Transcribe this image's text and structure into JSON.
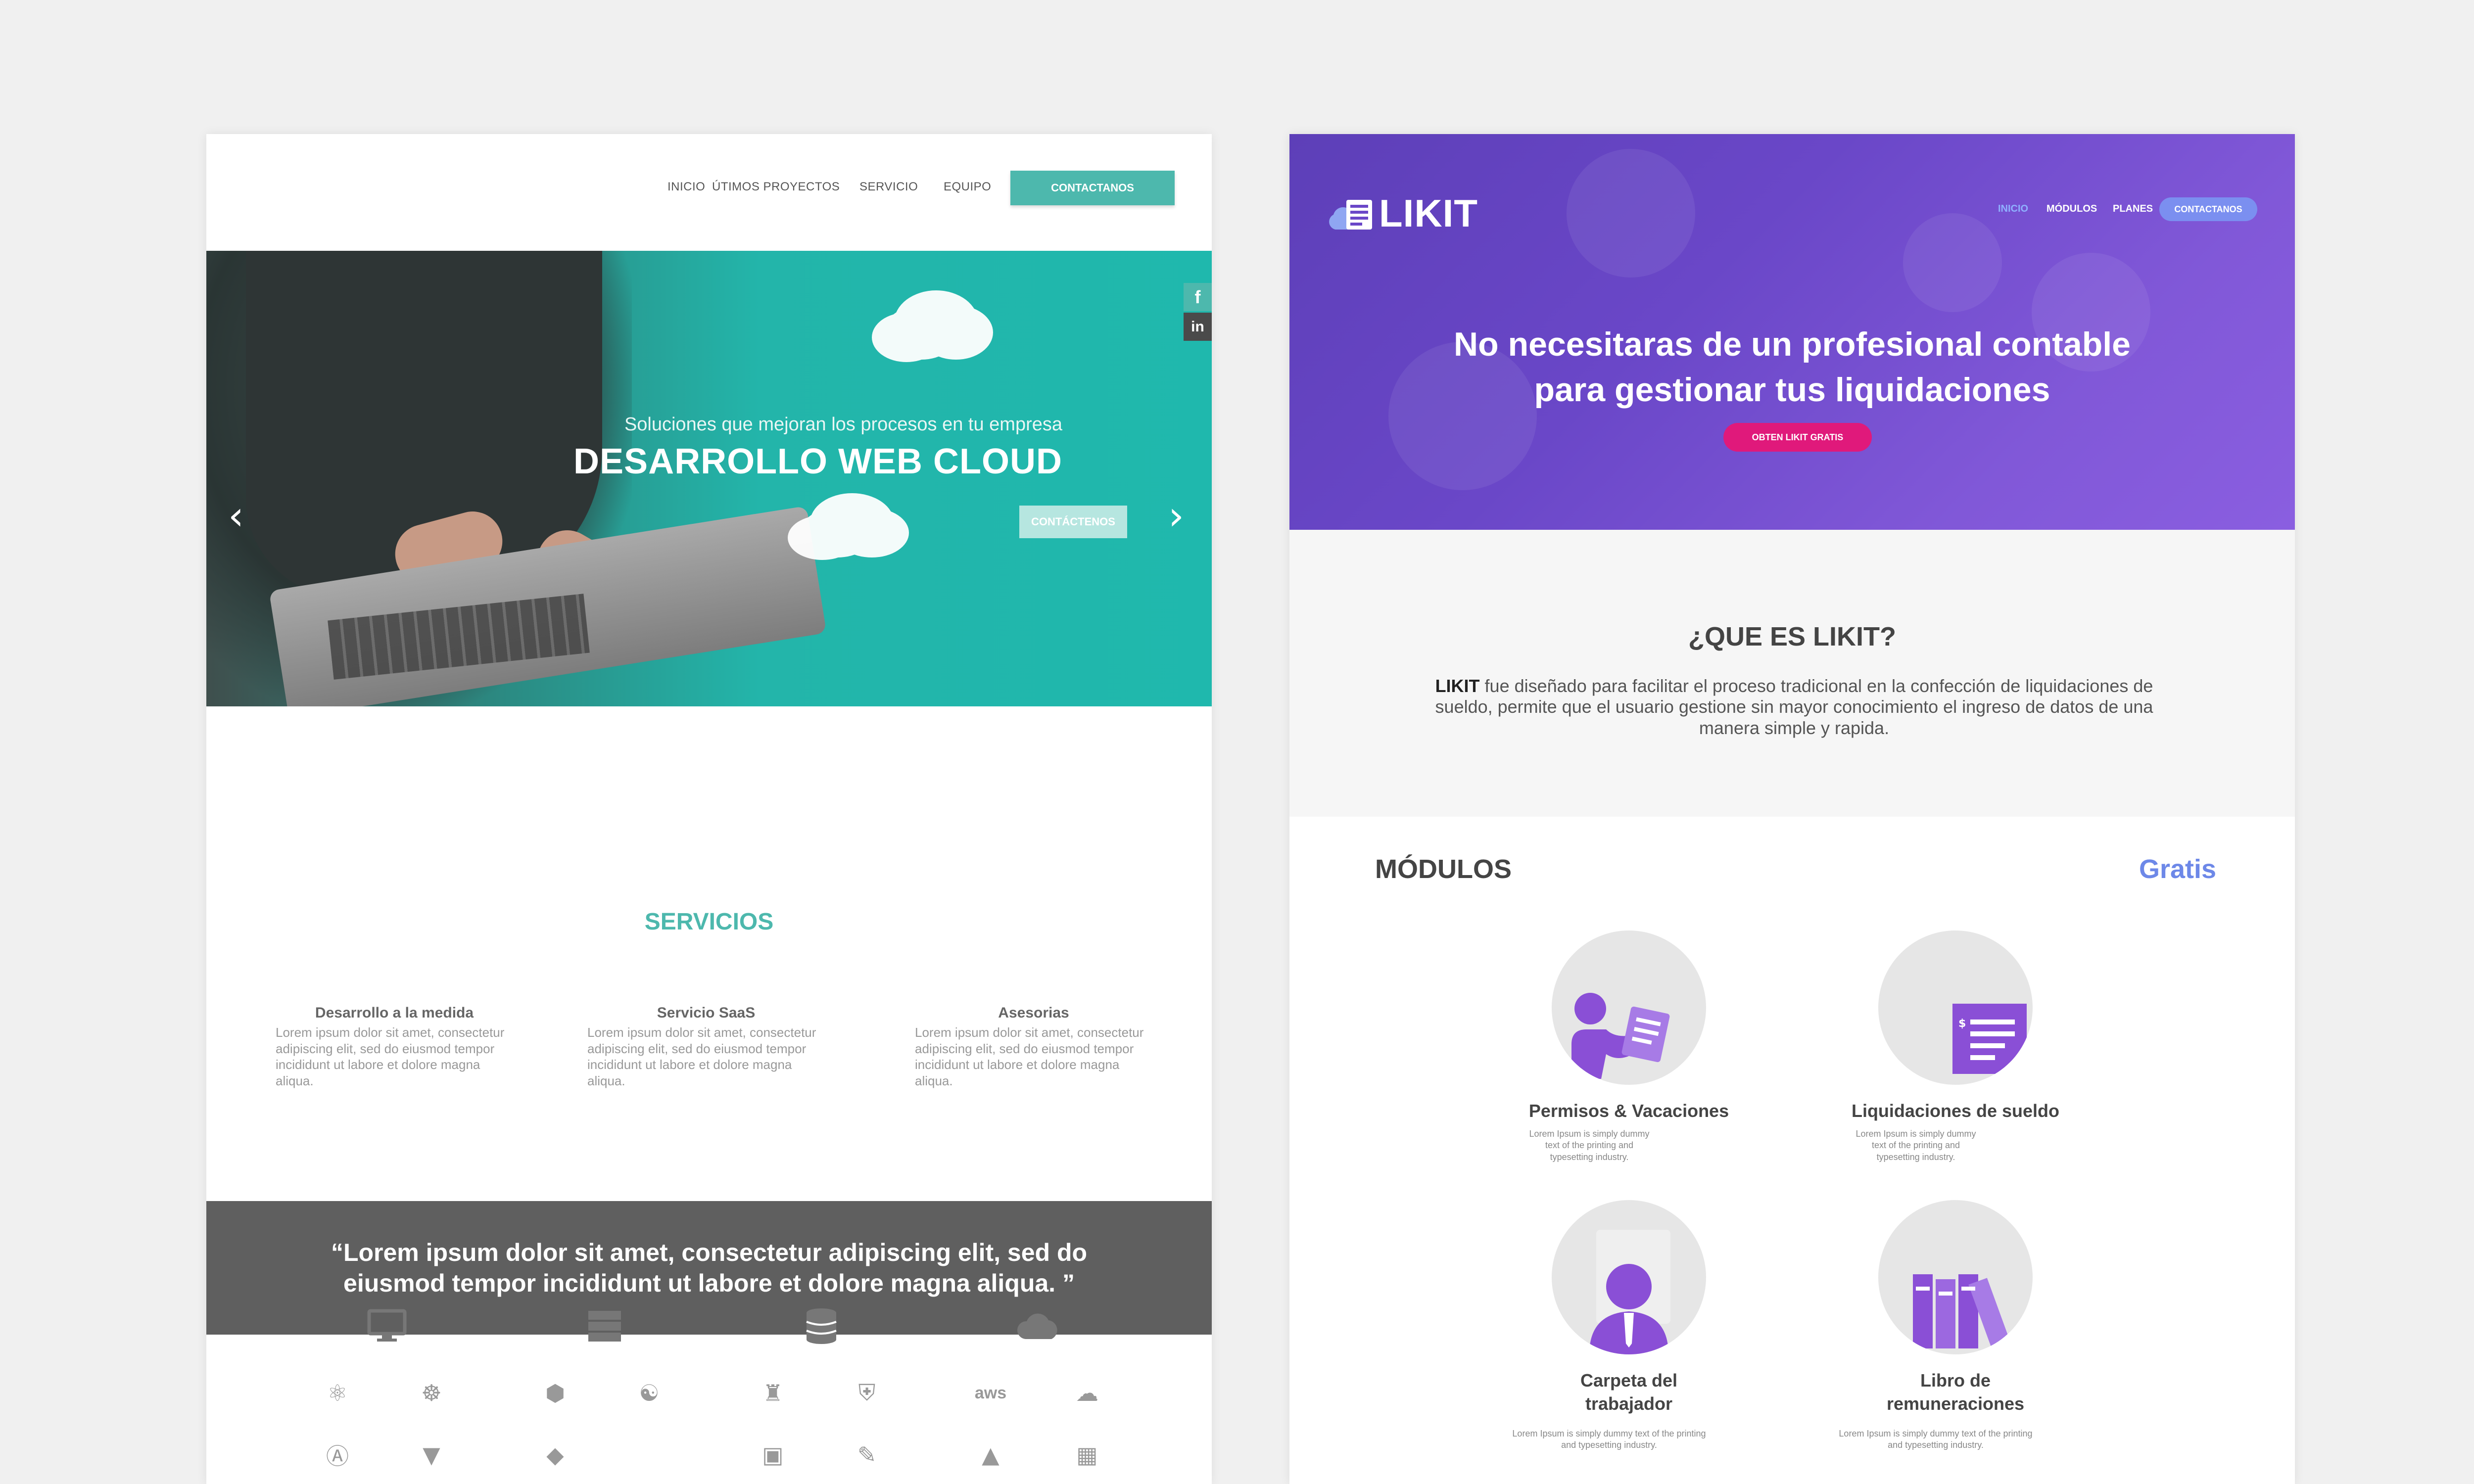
{
  "left_site": {
    "nav": {
      "items": [
        "INICIO",
        "ÚTIMOS PROYECTOS",
        "SERVICIO",
        "EQUIPO"
      ],
      "cta": "CONTACTANOS"
    },
    "hero": {
      "subtitle": "Soluciones que mejoran los procesos en tu empresa",
      "title": "DESARROLLO WEB CLOUD",
      "button": "CONTÁCTENOS",
      "prev_icon": "chevron-left-icon",
      "next_icon": "chevron-right-icon",
      "social": [
        "facebook-icon",
        "linkedin-icon"
      ],
      "social_glyphs": [
        "f",
        "in"
      ]
    },
    "services": {
      "title": "SERVICIOS",
      "items": [
        {
          "title": "Desarrollo a la medida",
          "text": "Lorem ipsum dolor sit amet, consectetur adipiscing elit, sed do eiusmod tempor incididunt ut labore et dolore magna aliqua."
        },
        {
          "title": "Servicio SaaS",
          "text": "Lorem ipsum dolor sit amet, consectetur adipiscing elit, sed do eiusmod tempor incididunt ut labore et dolore magna aliqua."
        },
        {
          "title": "Asesorias",
          "text": "Lorem ipsum dolor sit amet, consectetur adipiscing elit, sed do eiusmod tempor incididunt ut labore et dolore magna aliqua."
        }
      ]
    },
    "quote": "“Lorem ipsum dolor sit amet, consectetur adipiscing elit, sed do eiusmod tempor incididunt ut labore et dolore magna aliqua. ”",
    "tech": {
      "categories": [
        "monitor-icon",
        "server-icon",
        "database-icon",
        "cloud-icon"
      ],
      "labels": [
        "aws"
      ]
    },
    "colors": {
      "accent": "#4db8ad",
      "quote_bg": "#5f5f5f"
    }
  },
  "right_site": {
    "logo": "LIKIT",
    "nav": {
      "items": [
        "INICIO",
        "MÓDULOS",
        "PLANES"
      ],
      "cta": "CONTACTANOS"
    },
    "hero": {
      "title_line1": "No necesitaras de un profesional contable",
      "title_line2": "para gestionar tus liquidaciones",
      "button": "OBTEN LIKIT GRATIS"
    },
    "about": {
      "title": "¿QUE ES LIKIT?",
      "brand": "LIKIT",
      "text": " fue diseñado para facilitar el proceso tradicional en la confección de liquidaciones de sueldo, permite que el usuario gestione sin mayor conocimiento el ingreso de datos de una manera simple y rapida."
    },
    "modules": {
      "title": "MÓDULOS",
      "badge": "Gratis",
      "items": [
        {
          "name": "Permisos & Vacaciones",
          "desc": "Lorem Ipsum is simply dummy text of the printing and typesetting industry.",
          "icon": "clipboard-person-icon"
        },
        {
          "name": "Liquidaciones de sueldo",
          "desc": "Lorem Ipsum is simply dummy text of the printing and typesetting industry.",
          "icon": "invoice-icon"
        },
        {
          "name": "Carpeta del trabajador",
          "desc": "Lorem Ipsum is simply dummy text of the printing and typesetting industry.",
          "icon": "worker-icon"
        },
        {
          "name": "Libro de remuneraciones",
          "desc": "Lorem Ipsum is simply dummy text of the printing and typesetting industry.",
          "icon": "books-icon"
        }
      ]
    },
    "colors": {
      "primary": "#6a47c8",
      "pink": "#e0197b",
      "link": "#6d88e8"
    }
  }
}
